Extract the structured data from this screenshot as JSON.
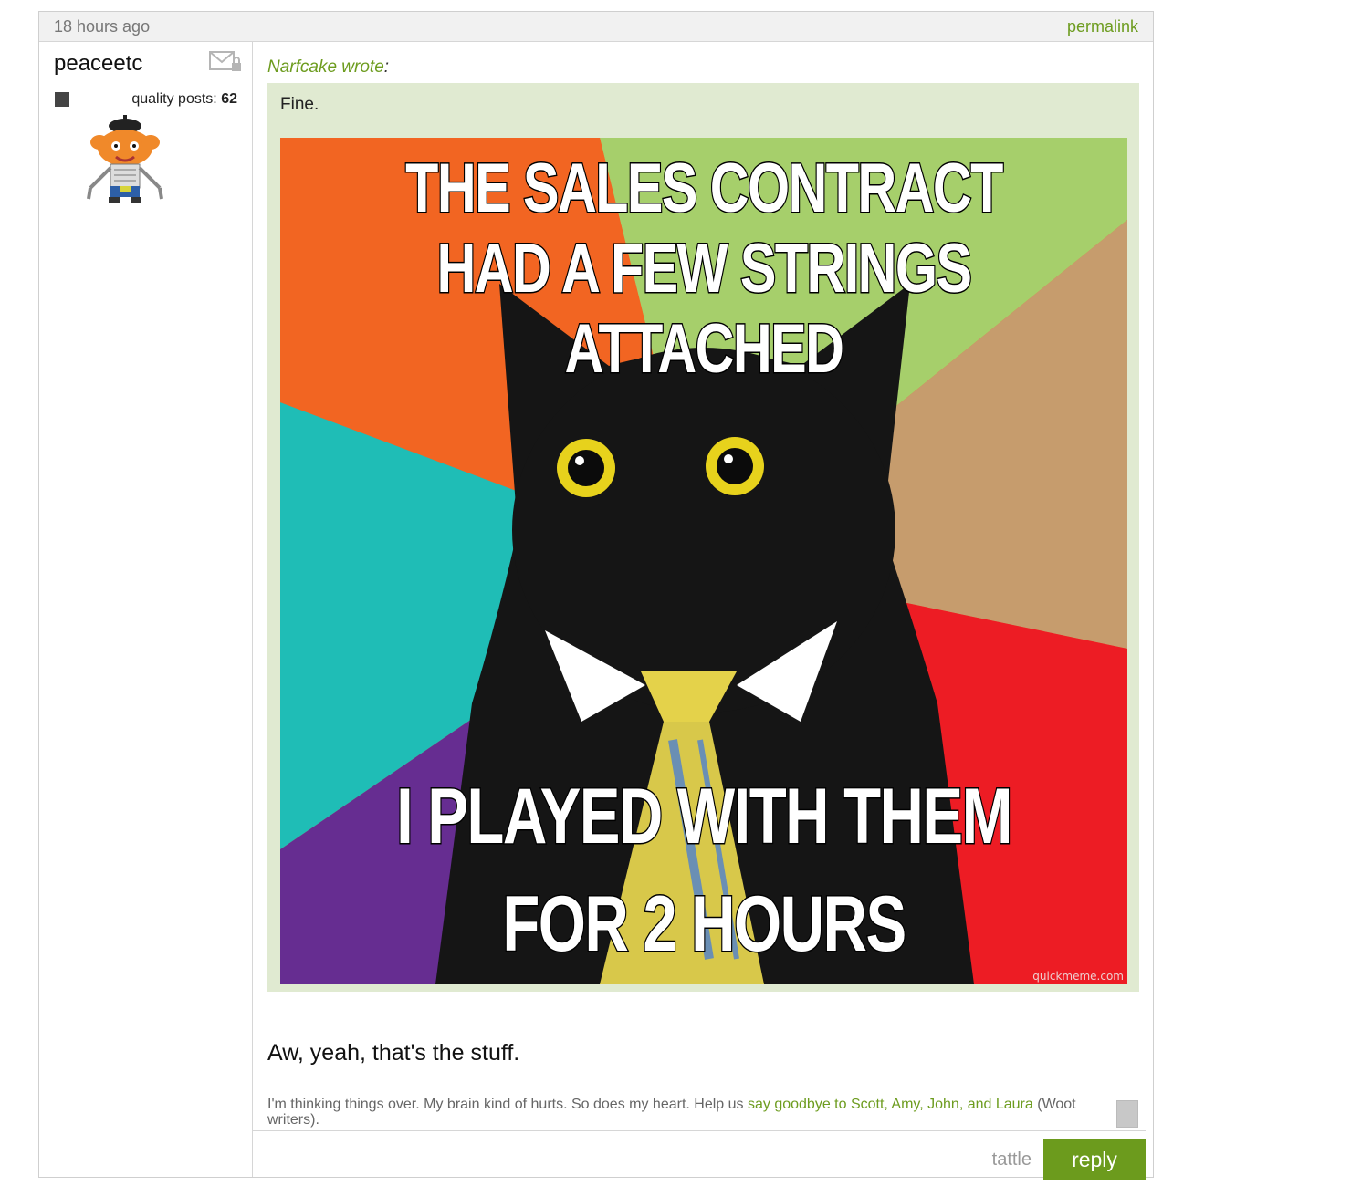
{
  "post": {
    "time": "18 hours ago",
    "permalink": "permalink"
  },
  "author": {
    "username": "peaceetc",
    "quality_label": "quality posts:",
    "quality_count": "62"
  },
  "quote": {
    "author": "Narfcake wrote",
    "colon": ":",
    "text": "Fine."
  },
  "meme": {
    "top_text": "THE SALES CONTRACT HAD A FEW STRINGS ATTACHED",
    "bottom_text": "I PLAYED WITH THEM FOR 2 HOURS",
    "watermark": "quickmeme.com"
  },
  "body": {
    "text": "Aw, yeah, that's the stuff."
  },
  "signature": {
    "prefix": "I'm thinking things over. My brain kind of hurts. So does my heart. Help us",
    "link": "say goodbye to Scott, Amy, John, and Laura",
    "suffix": "(Woot writers)."
  },
  "actions": {
    "tattle": "tattle",
    "reply": "reply"
  },
  "colors": {
    "accent": "#6c9b1d",
    "quote_bg": "#e0ead1",
    "header_bg": "#f1f1f1"
  }
}
